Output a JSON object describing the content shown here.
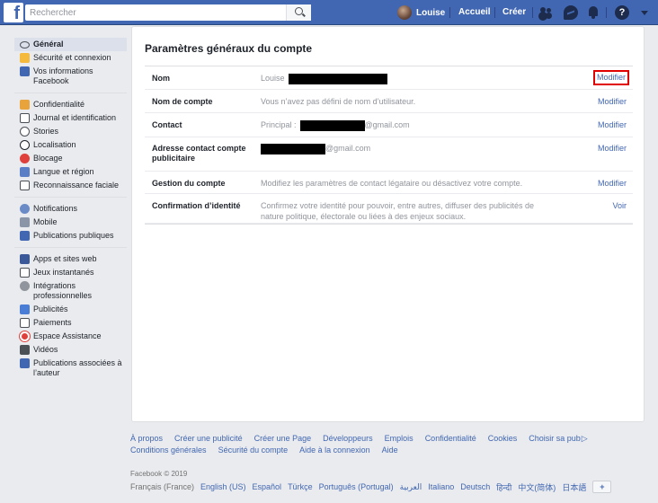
{
  "header": {
    "logo": "f",
    "search_placeholder": "Rechercher",
    "user_name": "Louise",
    "home": "Accueil",
    "create": "Créer",
    "help_glyph": "?"
  },
  "sidebar": {
    "groups": [
      [
        {
          "label": "Général",
          "icon": "gear-icon",
          "active": true
        },
        {
          "label": "Sécurité et connexion",
          "icon": "shield-icon"
        },
        {
          "label": "Vos informations Facebook",
          "icon": "facebook-icon"
        }
      ],
      [
        {
          "label": "Confidentialité",
          "icon": "lock-icon"
        },
        {
          "label": "Journal et identification",
          "icon": "timeline-icon"
        },
        {
          "label": "Stories",
          "icon": "stories-icon"
        },
        {
          "label": "Localisation",
          "icon": "location-icon"
        },
        {
          "label": "Blocage",
          "icon": "block-icon"
        },
        {
          "label": "Langue et région",
          "icon": "language-icon"
        },
        {
          "label": "Reconnaissance faciale",
          "icon": "face-icon"
        }
      ],
      [
        {
          "label": "Notifications",
          "icon": "globe-icon"
        },
        {
          "label": "Mobile",
          "icon": "mobile-icon"
        },
        {
          "label": "Publications publiques",
          "icon": "rss-icon"
        }
      ],
      [
        {
          "label": "Apps et sites web",
          "icon": "apps-icon"
        },
        {
          "label": "Jeux instantanés",
          "icon": "games-icon"
        },
        {
          "label": "Intégrations professionnelles",
          "icon": "integrations-icon"
        },
        {
          "label": "Publicités",
          "icon": "ads-icon"
        },
        {
          "label": "Paiements",
          "icon": "payments-icon"
        },
        {
          "label": "Espace Assistance",
          "icon": "support-icon"
        },
        {
          "label": "Vidéos",
          "icon": "video-icon"
        },
        {
          "label": "Publications associées à l’auteur",
          "icon": "author-icon"
        }
      ]
    ]
  },
  "main": {
    "title": "Paramètres généraux du compte",
    "rows": [
      {
        "label": "Nom",
        "value_prefix": "Louise",
        "value_suffix": "",
        "action": "Modifier",
        "highlight": true
      },
      {
        "label": "Nom de compte",
        "value_prefix": "Vous n’avez pas défini de nom d’utilisateur.",
        "value_suffix": "",
        "action": "Modifier"
      },
      {
        "label": "Contact",
        "value_prefix": "Principal :",
        "value_suffix": "@gmail.com",
        "action": "Modifier"
      },
      {
        "label": "Adresse contact compte publicitaire",
        "value_prefix": "",
        "value_suffix": "@gmail.com",
        "action": "Modifier"
      },
      {
        "label": "Gestion du compte",
        "value_prefix": "Modifiez les paramètres de contact légataire ou désactivez votre compte.",
        "value_suffix": "",
        "action": "Modifier"
      },
      {
        "label": "Confirmation d’identité",
        "value_prefix": "Confirmez votre identité pour pouvoir, entre autres, diffuser des publicités de nature politique, électorale ou liées à des enjeux sociaux.",
        "value_suffix": "",
        "action": "Voir"
      }
    ]
  },
  "footer": {
    "links_row1": [
      "À propos",
      "Créer une publicité",
      "Créer une Page",
      "Développeurs",
      "Emplois",
      "Confidentialité",
      "Cookies",
      "Choisir sa pub"
    ],
    "links_row2": [
      "Conditions générales",
      "Sécurité du compte",
      "Aide à la connexion",
      "Aide"
    ],
    "copyright": "Facebook © 2019",
    "current_language": "Français (France)",
    "languages": [
      "English (US)",
      "Español",
      "Türkçe",
      "Português (Portugal)",
      "العربية",
      "Italiano",
      "Deutsch",
      "हिन्दी",
      "中文(简体)",
      "日本語"
    ],
    "add_language": "+"
  },
  "colors": {
    "brand": "#4267b2",
    "link": "#4267b2",
    "highlight_border": "#e00000"
  }
}
